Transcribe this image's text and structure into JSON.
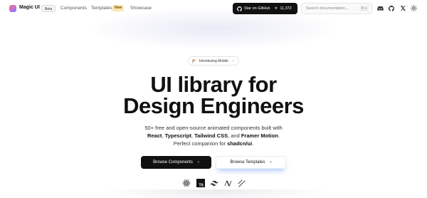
{
  "header": {
    "brand": "Magic UI",
    "badge": "Beta",
    "nav": [
      {
        "label": "Components"
      },
      {
        "label": "Templates",
        "badge": "New"
      },
      {
        "label": "Showcase"
      }
    ],
    "github_button": {
      "label": "Star on GitHub",
      "stars": "11,372"
    },
    "search": {
      "placeholder": "Search documentation...",
      "shortcut": "⌘ K"
    },
    "icons": [
      "discord-icon",
      "github-icon",
      "x-icon",
      "theme-toggle-icon"
    ]
  },
  "hero": {
    "announcement": "Introducing Mobile",
    "title_line1": "UI library for",
    "title_line2": "Design Engineers",
    "subtitle": {
      "line1": "50+ free and open-source animated components built with",
      "tech": [
        "React",
        "Typescript",
        "Tailwind CSS",
        "Framer Motion"
      ],
      "sep1": ", ",
      "sep2": ", ",
      "sep3": ", and ",
      "end1": ".",
      "line3_prefix": "Perfect companion for ",
      "line3_strong": "shadcn/ui",
      "line3_end": "."
    },
    "primary_cta": "Browse Components",
    "secondary_cta": "Browse Templates",
    "tech_icons": [
      "react-icon",
      "typescript-icon",
      "tailwind-icon",
      "framer-motion-icon",
      "shadcn-icon"
    ]
  },
  "colors": {
    "primary_button": "#111111",
    "new_badge": "#fde7b0",
    "secondary_glow": "#508cff"
  }
}
